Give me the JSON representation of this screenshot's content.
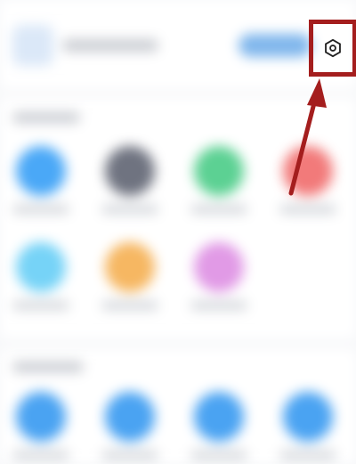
{
  "screen": {
    "background": "#f7f8fa",
    "blurred": true
  },
  "header": {
    "settings_icon": "gear-icon"
  },
  "annotation": {
    "color": "#a41e1e",
    "target": "settings-button"
  },
  "sections": [
    {
      "items": [
        {
          "color": "#4aa8f7"
        },
        {
          "color": "#6f7380"
        },
        {
          "color": "#5cd193"
        },
        {
          "color": "#f27a7a"
        },
        {
          "color": "#76d3f7"
        },
        {
          "color": "#f6b762"
        },
        {
          "color": "#e19ae6"
        }
      ]
    },
    {
      "items": [
        {
          "color": "#4aa3f2"
        },
        {
          "color": "#4aa3f2"
        },
        {
          "color": "#4aa3f2"
        },
        {
          "color": "#4aa3f2"
        }
      ]
    }
  ]
}
